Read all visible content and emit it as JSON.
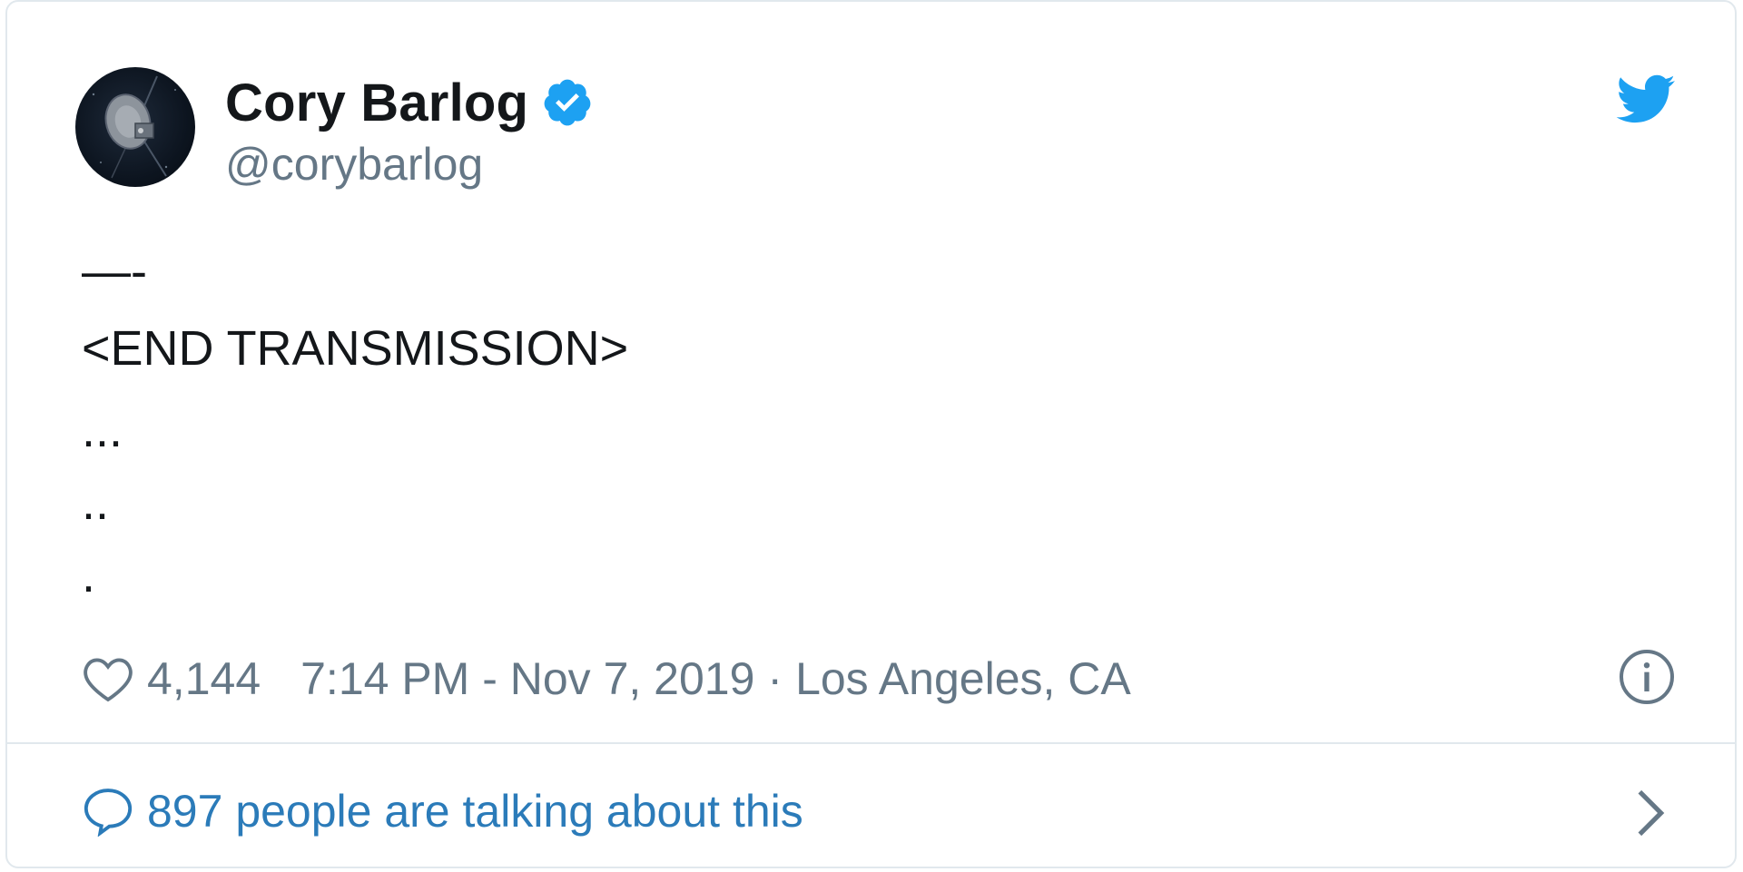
{
  "author": {
    "display_name": "Cory Barlog",
    "handle": "@corybarlog",
    "verified": true,
    "avatar_icon": "voyager-probe-avatar"
  },
  "brand": {
    "logo_icon": "twitter-bird-icon",
    "accent_color": "#1da1f2",
    "link_color": "#2b7bb9",
    "text_color": "#14171a",
    "muted_color": "#657786"
  },
  "tweet": {
    "lines": [
      "—-",
      "<END TRANSMISSION>",
      "...",
      "..",
      "."
    ]
  },
  "meta": {
    "like_icon": "heart-icon",
    "like_count": "4,144",
    "timestamp": "7:14 PM - Nov 7, 2019",
    "separator": "·",
    "location": "Los Angeles, CA",
    "info_icon": "info-icon"
  },
  "footer": {
    "reply_icon": "reply-bubble-icon",
    "talking_text": "897 people are talking about this",
    "chevron_icon": "chevron-right-icon"
  }
}
